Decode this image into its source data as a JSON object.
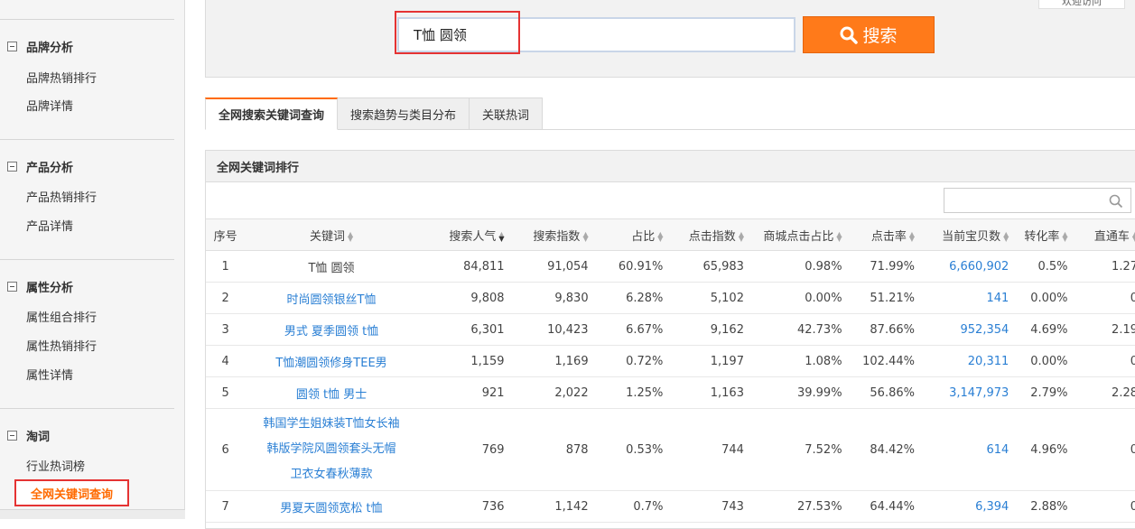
{
  "sidebar": {
    "groups": [
      {
        "title": "品牌分析",
        "items": [
          "品牌热销排行",
          "品牌详情"
        ]
      },
      {
        "title": "产品分析",
        "items": [
          "产品热销排行",
          "产品详情"
        ]
      },
      {
        "title": "属性分析",
        "items": [
          "属性组合排行",
          "属性热销排行",
          "属性详情"
        ]
      },
      {
        "title": "淘词",
        "items": [
          "行业热词榜"
        ]
      }
    ],
    "active_item": "全网关键词查询"
  },
  "search": {
    "value": "T恤 圆领",
    "button_label": "搜索",
    "top_tag": "欢迎访问"
  },
  "tabs": [
    "全网搜索关键词查询",
    "搜索趋势与类目分布",
    "关联热词"
  ],
  "panel": {
    "title": "全网关键词排行",
    "filter_placeholder": ""
  },
  "table": {
    "headers": [
      "序号",
      "关键词",
      "搜索人气",
      "搜索指数",
      "占比",
      "点击指数",
      "商城点击占比",
      "点击率",
      "当前宝贝数",
      "转化率",
      "直通车"
    ],
    "rows": [
      {
        "no": "1",
        "kw": [
          "T恤 圆领"
        ],
        "pop": "84,811",
        "idx": "91,054",
        "share": "60.91%",
        "click": "65,983",
        "mall": "0.98%",
        "ctr": "71.99%",
        "items": "6,660,902",
        "conv": "0.5%",
        "ztc": "1.27"
      },
      {
        "no": "2",
        "kw": [
          "时尚圆领银丝T恤"
        ],
        "pop": "9,808",
        "idx": "9,830",
        "share": "6.28%",
        "click": "5,102",
        "mall": "0.00%",
        "ctr": "51.21%",
        "items": "141",
        "conv": "0.00%",
        "ztc": "0"
      },
      {
        "no": "3",
        "kw": [
          "男式 夏季圆领 t恤"
        ],
        "pop": "6,301",
        "idx": "10,423",
        "share": "6.67%",
        "click": "9,162",
        "mall": "42.73%",
        "ctr": "87.66%",
        "items": "952,354",
        "conv": "4.69%",
        "ztc": "2.19"
      },
      {
        "no": "4",
        "kw": [
          "T恤潮圆领修身TEE男"
        ],
        "pop": "1,159",
        "idx": "1,169",
        "share": "0.72%",
        "click": "1,197",
        "mall": "1.08%",
        "ctr": "102.44%",
        "items": "20,311",
        "conv": "0.00%",
        "ztc": "0"
      },
      {
        "no": "5",
        "kw": [
          "圆领 t恤 男士"
        ],
        "pop": "921",
        "idx": "2,022",
        "share": "1.25%",
        "click": "1,163",
        "mall": "39.99%",
        "ctr": "56.86%",
        "items": "3,147,973",
        "conv": "2.79%",
        "ztc": "2.28"
      },
      {
        "no": "6",
        "kw": [
          "韩国学生姐妹装T恤女长袖",
          "韩版学院风圆领套头无帽",
          "卫衣女春秋薄款"
        ],
        "pop": "769",
        "idx": "878",
        "share": "0.53%",
        "click": "744",
        "mall": "7.52%",
        "ctr": "84.42%",
        "items": "614",
        "conv": "4.96%",
        "ztc": "0"
      },
      {
        "no": "7",
        "kw": [
          "男夏天圆领宽松 t恤"
        ],
        "pop": "736",
        "idx": "1,142",
        "share": "0.7%",
        "click": "743",
        "mall": "27.53%",
        "ctr": "64.44%",
        "items": "6,394",
        "conv": "2.88%",
        "ztc": "0"
      }
    ]
  },
  "colors": {
    "accent": "#ff7a1a",
    "link": "#2a7fd4",
    "highlight": "#e53333"
  }
}
